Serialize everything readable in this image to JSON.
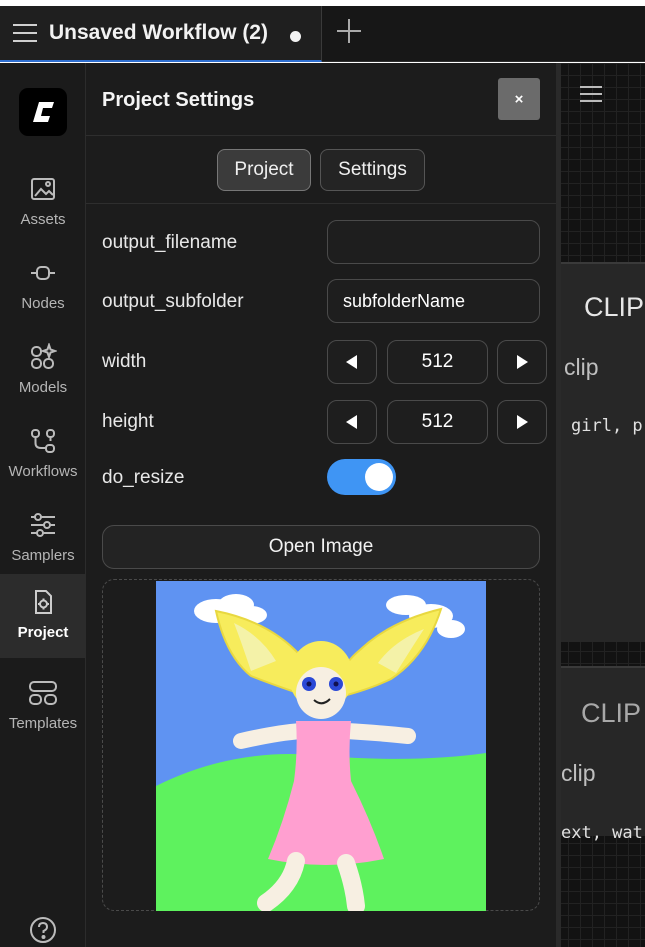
{
  "tab": {
    "title": "Unsaved Workflow (2)"
  },
  "rail": {
    "items": [
      {
        "label": "Assets"
      },
      {
        "label": "Nodes"
      },
      {
        "label": "Models"
      },
      {
        "label": "Workflows"
      },
      {
        "label": "Samplers"
      },
      {
        "label": "Project"
      },
      {
        "label": "Templates"
      }
    ],
    "active": "Project"
  },
  "panel": {
    "title": "Project Settings",
    "close_label": "×",
    "tabs": [
      {
        "label": "Project"
      },
      {
        "label": "Settings"
      }
    ],
    "fields": {
      "output_filename": {
        "label": "output_filename",
        "value": ""
      },
      "output_subfolder": {
        "label": "output_subfolder",
        "value": "subfolderName"
      },
      "width": {
        "label": "width",
        "value": "512"
      },
      "height": {
        "label": "height",
        "value": "512"
      },
      "do_resize": {
        "label": "do_resize",
        "checked": true
      }
    },
    "open_image_label": "Open Image"
  },
  "canvas": {
    "node1": {
      "title": "CLIP",
      "sub": "clip",
      "text": "girl, p"
    },
    "node2": {
      "title": "CLIP",
      "sub": "clip",
      "text": "ext, wat"
    }
  },
  "colors": {
    "accent": "#3f95f4",
    "tab_underline": "#2f6fd0"
  }
}
